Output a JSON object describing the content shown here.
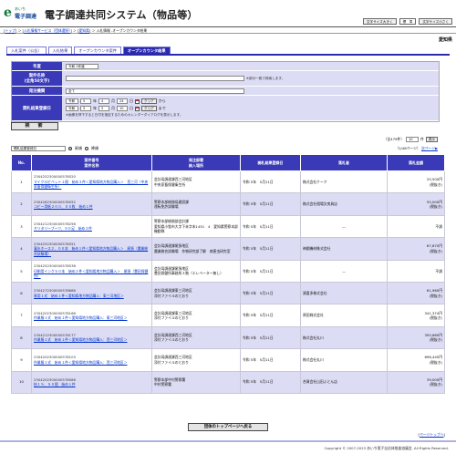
{
  "header": {
    "logo_mark": "e",
    "logo_small": "あいち",
    "logo_big": "電子調達",
    "title": "電子調達共同システム（物品等）",
    "font_buttons": [
      "文字サイズ大きく",
      "標　準",
      "文字サイズ小さく"
    ]
  },
  "breadcrumb": {
    "items": [
      "トップ",
      "入札情報サービス（団体選択）",
      "愛知県"
    ],
    "current": "入札情報 -オープンカウンタ結果"
  },
  "prefecture": "愛知県",
  "tabs": [
    "入札案件（公告）",
    "入札結果",
    "オープンカウンタ案件",
    "オープンカウンタ結果"
  ],
  "form": {
    "row1": {
      "label": "年度",
      "value": "令和 5年度"
    },
    "row2": {
      "label1": "案件名称",
      "label2": "(全角50文字)",
      "value": "",
      "note": "※部分一致で検索します。"
    },
    "row3": {
      "label": "発注機関",
      "value": "全て"
    },
    "row4": {
      "label": "開札結果登録日",
      "from": {
        "era": "令和",
        "year": "5",
        "year_unit": "年",
        "month": "4",
        "month_unit": "月",
        "day": "24",
        "day_unit": "日",
        "clear": "クリア",
        "suffix": "から"
      },
      "to": {
        "era": "令和",
        "year": "5",
        "year_unit": "年",
        "month": "5",
        "month_unit": "月",
        "day": "10",
        "day_unit": "日",
        "clear": "クリア",
        "suffix": "まで"
      },
      "note": "※画像を押下すると日付を指定するためのカレンダーダイアログを表示します。"
    }
  },
  "search_button": "検　索",
  "result_info": {
    "total": "（全479件）",
    "per_page": "10",
    "per_page_unit": "件",
    "display": "表示"
  },
  "sort": {
    "select": "開札結果登録日",
    "asc": "昇順",
    "desc": "降順",
    "pages": "（1/48ページ）",
    "next": "次ページ▶"
  },
  "table": {
    "headers": {
      "no": "No.",
      "case1": "案件番号",
      "case2": "案件名称",
      "org1": "発注部署",
      "org2": "納入場所",
      "date": "開札結果登録日",
      "winner": "落札者",
      "amount1": "落札金額"
    },
    "rows": [
      {
        "no": "1",
        "case_no": "2304252300000578520",
        "name": "マイクロピペット１個　始め３件＜愛知県地方物品購入＞　西三河（中央家畜保健衛生所）",
        "org": "会計局調達課西三河地区",
        "place": "中央家畜保健衛生所",
        "date": "令和 5年　5月11日",
        "winner": "株式会社ケーク",
        "amount": "25,500円",
        "tax": "(税抜き)"
      },
      {
        "no": "2",
        "case_no": "2304282300000578052",
        "name": "コピー用紙２００、００枚　始め１件",
        "org": "警察本部総務局建設課",
        "place": "運転免許試験場",
        "date": "令和 5年　5月11日",
        "winner": "株式会社相場文房具店",
        "amount": "55,000円",
        "tax": "(税抜き)"
      },
      {
        "no": "3",
        "case_no": "2304212300000578256",
        "name": "ミリタリーブーツ、９０足　始め２件",
        "org": "警察本部総務部会計課",
        "place": "愛知県小牧市大字下末字末1451　4　愛知県警察本部機動隊",
        "date": "令和 5年　5月11日",
        "winner": "—",
        "amount": "不調",
        "tax": ""
      },
      {
        "no": "4",
        "case_no": "2304252300000578551",
        "name": "凝水ホース２、００本　始め１件＜愛知県地方物品購入＞　尾張（農業総合試験場）",
        "org": "会計局調達課尾張地区",
        "place": "農業総合試験場　作物研究部了解　病害虫研究室",
        "date": "令和 5年　5月11日",
        "winner": "神鋼機材株式会社",
        "amount": "67,870円",
        "tax": "(税抜き)"
      },
      {
        "no": "5",
        "case_no": "2304252300000578538",
        "name": "印刷用インク５０本　始め２件＜愛知県地方物品購入＞　尾張（豊田保健所）",
        "org": "会計局調達課尾張地区",
        "place": "豊田保健所事務所３階（エレベーター無し）",
        "date": "令和 5年　5月11日",
        "winner": "—",
        "amount": "不調",
        "tax": ""
      },
      {
        "no": "6",
        "case_no": "2304272300000578686",
        "name": "専用１式　始め１件＜愛知県地方物品購入：東三河地区＞",
        "org": "会計局調達課東三河地区",
        "place": "添付ファイルのとおり",
        "date": "令和 5年　5月11日",
        "winner": "源喜多株式会社",
        "amount": "61,960円",
        "tax": "(税抜き)"
      },
      {
        "no": "7",
        "case_no": "2304202300000578166",
        "name": "作業服１式　始め１件＜愛知県地方物品購入：東三河地区＞",
        "org": "会計局調達課東三河地区",
        "place": "添付ファイルのとおり",
        "date": "令和 5年　5月11日",
        "winner": "原田株式会社",
        "amount": "341,374円",
        "tax": "(税抜き)"
      },
      {
        "no": "8",
        "case_no": "2304212300000578177",
        "name": "作業服１式　始め１件＜愛知県地方物品購入：西三河地区＞",
        "org": "会計局調達課西三河地区",
        "place": "添付ファイルのとおり",
        "date": "令和 5年　5月11日",
        "winner": "株式会社丸川",
        "amount": "350,660円",
        "tax": "(税抜き)"
      },
      {
        "no": "9",
        "case_no": "2304202300000578103",
        "name": "作業服１式　始め１件＜愛知県地方物品購入：西三河地区＞",
        "org": "会計局調達課西三河地区",
        "place": "添付ファイルのとおり",
        "date": "令和 5年　5月11日",
        "winner": "株式会社丸川",
        "amount": "696,445円",
        "tax": "(税抜き)"
      },
      {
        "no": "10",
        "case_no": "2304202300000578086",
        "name": "枝１５、５０個　始め１件",
        "org": "警察本部中村警察署",
        "place": "中村警察署",
        "date": "令和 5年　5月11日",
        "winner": "合資会社山田ふとん店",
        "amount": "39,000円",
        "tax": "(税抜き)"
      }
    ]
  },
  "top_button": "団体のトップページへ戻る",
  "page_top": "ページトップへ",
  "footer": "Copyright © 2007-2023 あいち電子自治体推進協議会. All Rights Reserved."
}
